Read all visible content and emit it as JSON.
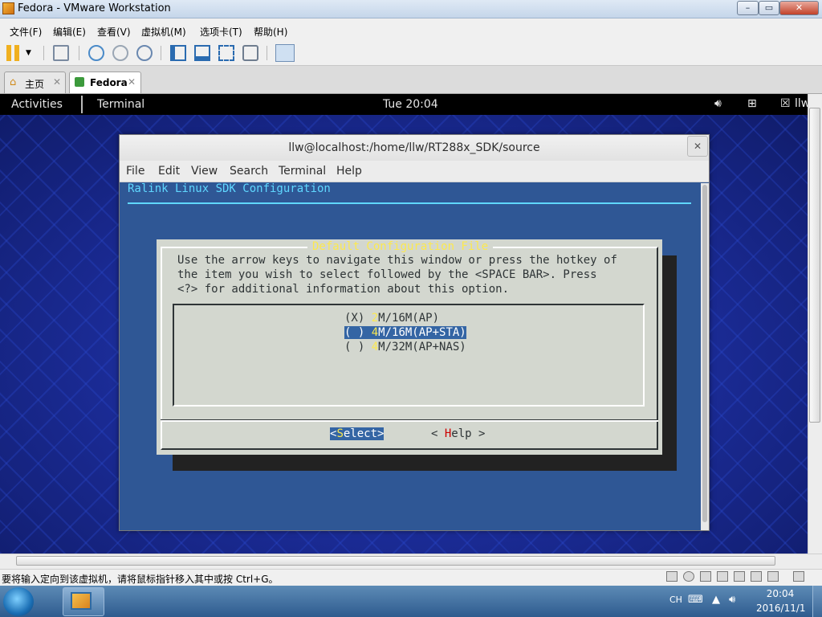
{
  "window": {
    "title": "Fedora - VMware Workstation",
    "min": "–",
    "max": "▭",
    "close": "✕"
  },
  "menubar": [
    "文件(F)",
    "编辑(E)",
    "查看(V)",
    "虚拟机(M)",
    "选项卡(T)",
    "帮助(H)"
  ],
  "tabs": [
    {
      "label": "主页",
      "close": "✕"
    },
    {
      "label": "Fedora",
      "close": "✕"
    }
  ],
  "gnome": {
    "activities": "Activities",
    "app": "Terminal",
    "clock": "Tue 20:04",
    "tray_user": "llw"
  },
  "terminal": {
    "title": "llw@localhost:/home/llw/RT288x_SDK/source",
    "close": "✕",
    "menu": [
      "File",
      "Edit",
      "View",
      "Search",
      "Terminal",
      "Help"
    ],
    "heading": "Ralink Linux SDK  Configuration"
  },
  "dialog": {
    "title": "Default Configuration File",
    "lines": [
      "Use the arrow keys to navigate this window or press the hotkey of",
      "the item you wish to select followed by the <SPACE BAR>. Press",
      "<?> for additional information about this option."
    ],
    "options": [
      {
        "mark": "(X) ",
        "hotkey": "2",
        "rest": "M/16M(AP)",
        "selected": false
      },
      {
        "mark": "( ) ",
        "hotkey": "4",
        "rest": "M/16M(AP+STA)",
        "selected": true
      },
      {
        "mark": "( ) ",
        "hotkey": "4",
        "rest": "M/32M(AP+NAS)",
        "selected": false
      }
    ],
    "select": {
      "left": "<",
      "hot": "S",
      "rest": "elect",
      "right": ">"
    },
    "help": {
      "left": "< ",
      "hot": "H",
      "rest": "elp",
      "right": " >"
    }
  },
  "status_text": "要将输入定向到该虚拟机，请将鼠标指针移入其中或按 Ctrl+G。",
  "taskbar": {
    "lang": "CH",
    "time": "20:04",
    "date": "2016/11/1"
  },
  "colors": {
    "guest_bg": "#1a2a8c",
    "terminal_bg": "#2f5795",
    "dialog_bg": "#d3d7cf",
    "hotkey": "#fce94f",
    "selected": "#3465a4"
  }
}
